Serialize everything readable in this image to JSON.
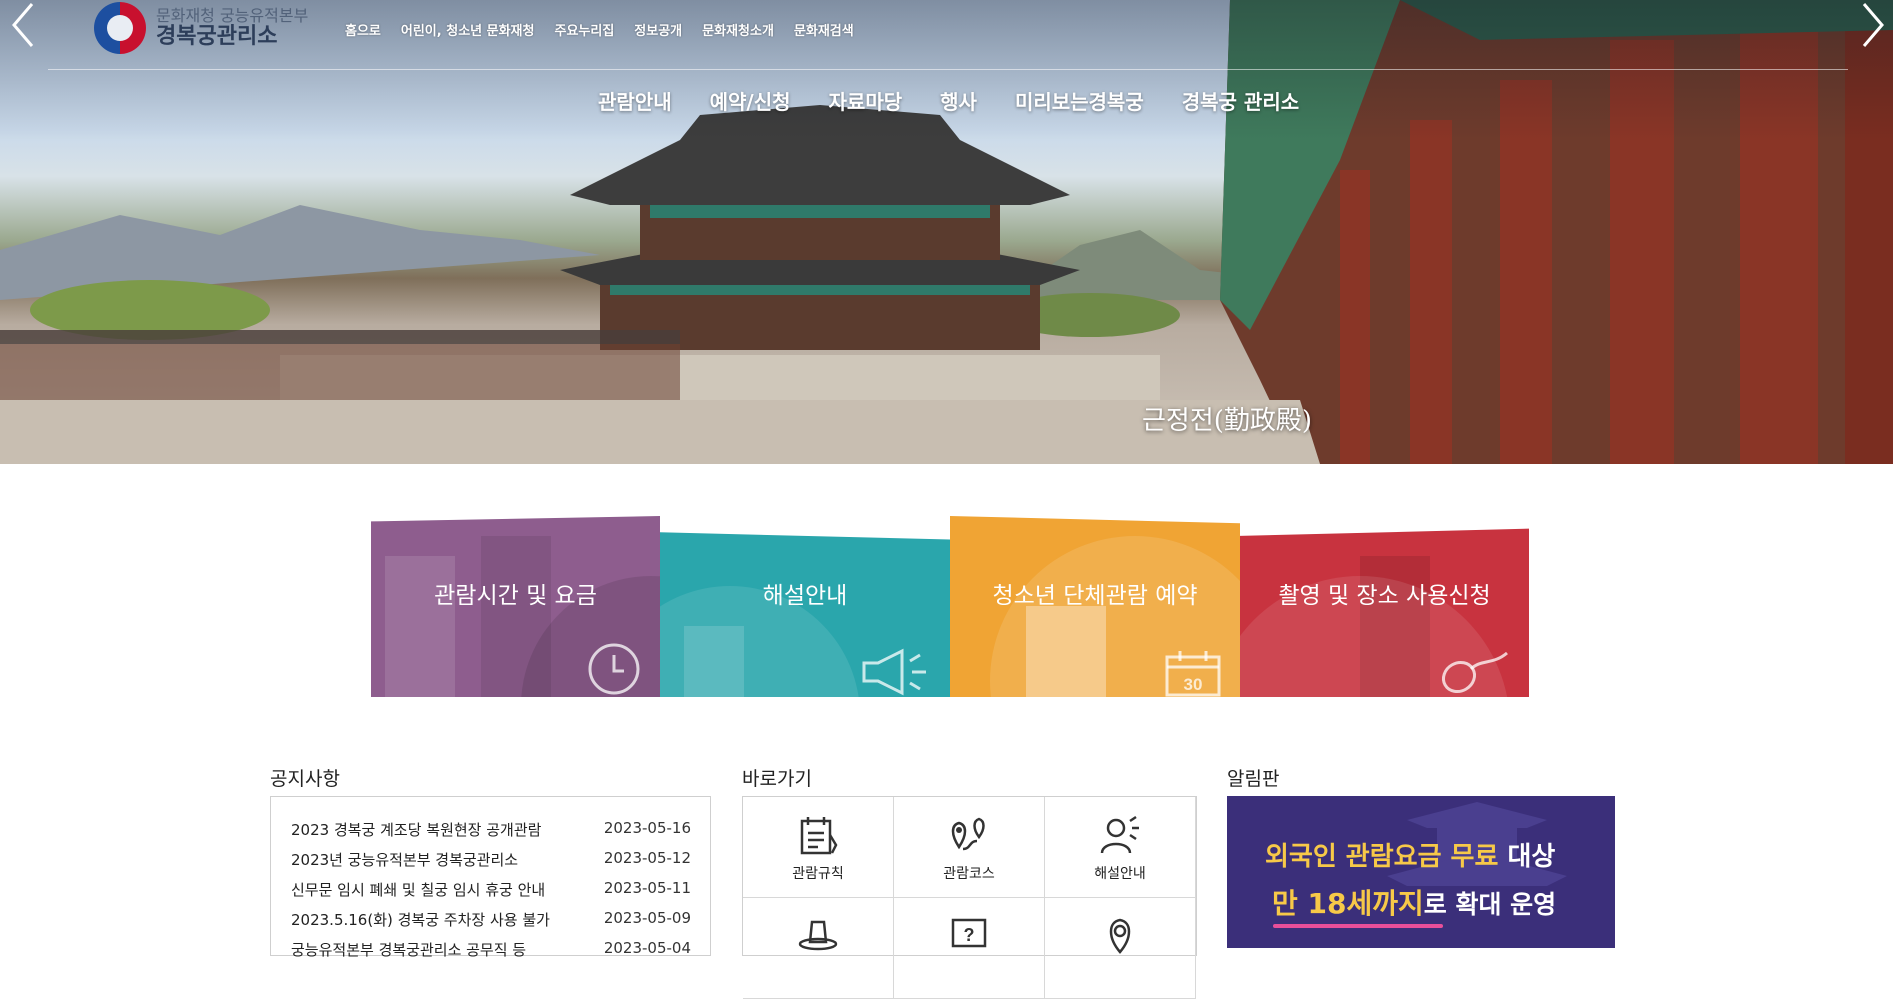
{
  "org": {
    "top": "문화재청 궁능유적본부",
    "name": "경복궁관리소"
  },
  "util_nav": [
    "홈으로",
    "어린이, 청소년 문화재청",
    "주요누리집",
    "정보공개",
    "문화재청소개",
    "문화재검색"
  ],
  "main_nav": [
    "관람안내",
    "예약/신청",
    "자료마당",
    "행사",
    "미리보는경복궁",
    "경복궁 관리소"
  ],
  "hero": {
    "caption": "근정전(勤政殿)"
  },
  "tiles": [
    {
      "label": "관람시간 및 요금",
      "icon": "clock-icon",
      "color": "#8e5d8e"
    },
    {
      "label": "해설안내",
      "icon": "megaphone-icon",
      "color": "#2aa6ac"
    },
    {
      "label": "청소년 단체관람 예약",
      "icon": "calendar-icon",
      "color": "#f0a434"
    },
    {
      "label": "촬영 및 장소 사용신청",
      "icon": "mouse-icon",
      "color": "#c8333f"
    }
  ],
  "notice": {
    "title": "공지사항",
    "items": [
      {
        "title": "2023 경복궁 계조당 복원현장 공개관람",
        "date": "2023-05-16"
      },
      {
        "title": "2023년 궁능유적본부 경복궁관리소",
        "date": "2023-05-12"
      },
      {
        "title": "신무문 임시 폐쇄 및 칠궁 임시 휴궁 안내",
        "date": "2023-05-11"
      },
      {
        "title": "2023.5.16(화) 경복궁 주차장 사용 불가",
        "date": "2023-05-09"
      },
      {
        "title": "궁능유적본부 경복궁관리소 공무직 등",
        "date": "2023-05-04"
      }
    ]
  },
  "quick": {
    "title": "바로가기",
    "items": [
      {
        "label": "관람규칙",
        "icon": "rules-icon"
      },
      {
        "label": "관람코스",
        "icon": "course-map-icon"
      },
      {
        "label": "해설안내",
        "icon": "guide-person-icon"
      },
      {
        "label": "",
        "icon": "hat-icon"
      },
      {
        "label": "",
        "icon": "question-icon"
      },
      {
        "label": "",
        "icon": "location-pin-icon"
      }
    ]
  },
  "board": {
    "title": "알림판",
    "line1_a": "외국인 관람요금 무료",
    "line1_b": " 대상",
    "line2_a": "만 18세까지",
    "line2_b": "로 확대 운영"
  }
}
